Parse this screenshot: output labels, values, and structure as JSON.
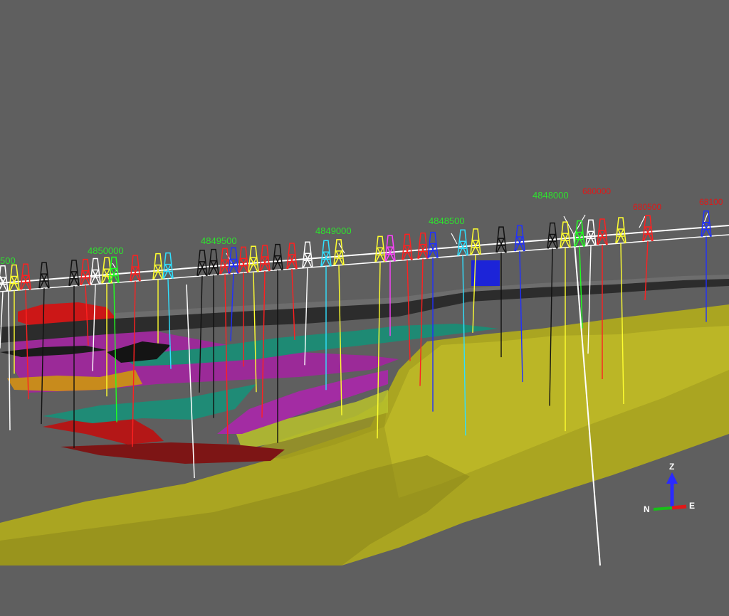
{
  "scene": {
    "background": "#5f5f5f",
    "surface_colors": {
      "ground": "#b5b021",
      "ground_dark": "#7d7816",
      "magenta": "#a02b9e",
      "teal": "#1f8c78",
      "red": "#cc1414",
      "dark_red": "#7a1111",
      "orange": "#c48a1b",
      "black": "#1a1a1a"
    },
    "northing_labels": [
      "500",
      "4850000",
      "4849500",
      "4849000",
      "4848500",
      "4848000"
    ],
    "easting_labels": [
      "680000",
      "680500",
      "68100"
    ],
    "rig_colors": [
      "#ffffff",
      "#ff2020",
      "#ffff30",
      "#20ff20",
      "#30e0ff",
      "#ff40ff",
      "#111111",
      "#2030ff"
    ]
  },
  "axis_triad": {
    "z_label": "Z",
    "n_label": "N",
    "e_label": "E",
    "z_color": "#2a2aff",
    "n_color": "#18c018",
    "e_color": "#e01818"
  }
}
